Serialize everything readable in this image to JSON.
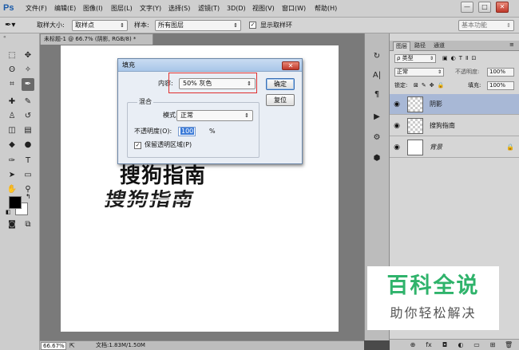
{
  "app": {
    "logo": "Ps",
    "menu": [
      "文件(F)",
      "编辑(E)",
      "图像(I)",
      "图层(L)",
      "文字(Y)",
      "选择(S)",
      "滤镜(T)",
      "3D(D)",
      "视图(V)",
      "窗口(W)",
      "帮助(H)"
    ],
    "window_buttons": [
      "—",
      "□",
      "✕"
    ]
  },
  "options_bar": {
    "sample_size_label": "取样大小:",
    "sample_size_value": "取样点",
    "sample_label": "样本:",
    "sample_value": "所有图层",
    "show_ring_label": "显示取样环",
    "show_ring_checked": "✓",
    "workspace_value": "基本功能"
  },
  "document": {
    "tab_title": "未标题-1 @ 66.7% (阴影, RGB/8) *",
    "canvas_text": "搜狗指南",
    "canvas_shadow_text": "搜狗指南",
    "zoom": "66.67%",
    "doc_info": "文档:1.83M/1.50M"
  },
  "dialog": {
    "title": "填充",
    "content_label": "内容:",
    "content_value": "50% 灰色",
    "ok_label": "确定",
    "reset_label": "复位",
    "blend_group_label": "混合",
    "mode_label": "模式:",
    "mode_value": "正常",
    "opacity_label": "不透明度(O):",
    "opacity_value": "100",
    "opacity_unit": "%",
    "preserve_label": "保留透明区域(P)",
    "preserve_checked": "✓"
  },
  "layers_panel": {
    "tabs": [
      "图层",
      "路径",
      "通道"
    ],
    "filter_label": "ρ 类型",
    "blend_mode": "正常",
    "opacity_label": "不透明度:",
    "opacity_value": "100%",
    "lock_label": "锁定:",
    "fill_label": "填充:",
    "fill_value": "100%",
    "layers": [
      {
        "name": "阴影",
        "selected": true
      },
      {
        "name": "搜狗指南",
        "selected": false
      },
      {
        "name": "背景",
        "selected": false
      }
    ],
    "footer_icons": [
      "⊕",
      "fx",
      "◘",
      "◐",
      "▭",
      "⊞",
      "🗑"
    ]
  },
  "watermark": {
    "line1": "百科全说",
    "line2": "助你轻松解决"
  }
}
